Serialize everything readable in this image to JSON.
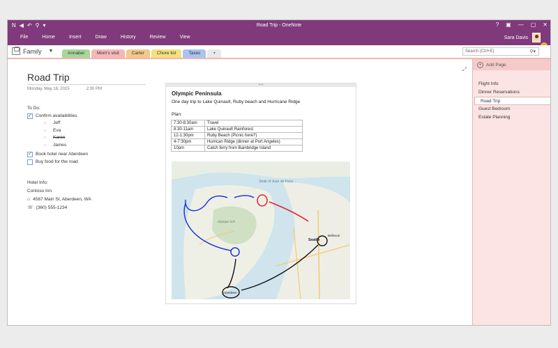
{
  "window": {
    "title": "Road Trip - OneNote"
  },
  "quick_access": {
    "icons": [
      "onenote-logo-icon",
      "back-icon",
      "undo-icon",
      "dock-icon",
      "customize-icon"
    ]
  },
  "window_controls": [
    "?",
    "▣",
    "—",
    "▢",
    "✕"
  ],
  "menu": [
    "File",
    "Home",
    "Insert",
    "Draw",
    "History",
    "Review",
    "View"
  ],
  "user": {
    "name": "Sara Davis"
  },
  "notebook": {
    "name": "Family"
  },
  "sections": [
    {
      "label": "Annabel",
      "color": "#a8d69a"
    },
    {
      "label": "Mom's visit",
      "color": "#f6b7b7"
    },
    {
      "label": "Carter",
      "color": "#f3c88a"
    },
    {
      "label": "Chore list",
      "color": "#f4e07c"
    },
    {
      "label": "Taxes",
      "color": "#a9c3ee"
    },
    {
      "label": "+",
      "color": "#e8e8e8"
    }
  ],
  "search": {
    "placeholder": "Search (Ctrl+E)"
  },
  "page": {
    "title": "Road Trip",
    "date": "Monday, May 18, 2015",
    "time": "2:00 PM",
    "todo": {
      "heading": "To Do:",
      "confirm": "Confirm availabilities",
      "people": [
        "Jeff",
        "Eva",
        "Karen",
        "James"
      ],
      "book_hotel": "Book hotel near Aberdeen",
      "buy_food": "Buy food for the road"
    },
    "hotel": {
      "heading": "Hotel Info:",
      "name": "Contoso Inn",
      "address": "4567 Main St, Aberdeen, WA",
      "phone": "(360) 555-1234"
    }
  },
  "note": {
    "title": "Olympic Peninsula",
    "subtitle": "One day trip to Lake Quinault, Ruby beach and Hurricane Ridge",
    "plan_label": "Plan:",
    "plan": [
      {
        "time": "7:30-8:30am",
        "activity": "Travel"
      },
      {
        "time": "8:30-11am",
        "activity": "Lake Quinault Rainforest"
      },
      {
        "time": "12-1:30pm",
        "activity": "Ruby Beach (Picnic here?)"
      },
      {
        "time": "4-7:30pm",
        "activity": "Hurrican Ridge (dinner at Port Angeles)"
      },
      {
        "time": "10pm",
        "activity": "Catch ferry from Bainbridge Island"
      }
    ],
    "map_labels": {
      "strait": "Strait of Juan de Fuca",
      "olympic": "Olympic N.P.",
      "seattle": "Seattle",
      "bellevue": "Bellevue",
      "aberdeen": "Aberdeen"
    }
  },
  "panel": {
    "add_page": "Add Page",
    "pages": [
      "Flight Info",
      "Dinner Reservations",
      "Road Trip",
      "Guest Bedroom",
      "Estate Planning"
    ],
    "active_index": 2
  },
  "colors": {
    "accent": "#80397b",
    "tab_underline": "#f2b4b4",
    "panel": "#fce4e4"
  }
}
